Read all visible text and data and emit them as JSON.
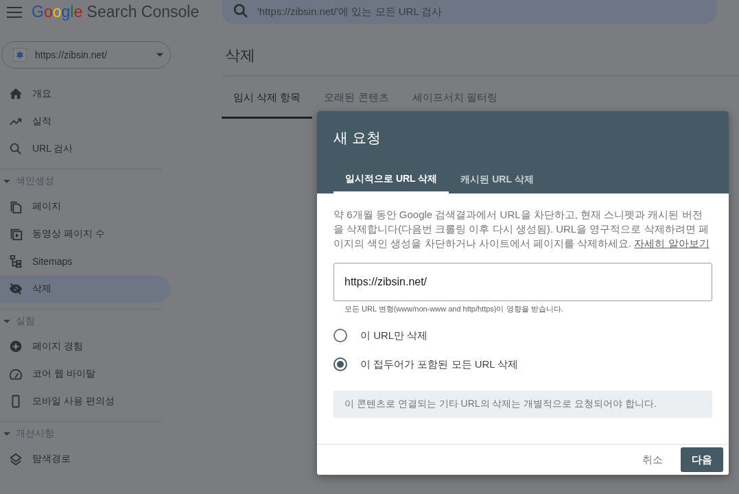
{
  "header": {
    "logo_brand": "Google",
    "logo_product": "Search Console",
    "search": {
      "placeholder": "'https://zibsin.net/'에 있는 모든 URL 검사"
    }
  },
  "property_selector": {
    "value": "https://zibsin.net/"
  },
  "sidebar": {
    "items": [
      {
        "label": "개요",
        "selected": false
      },
      {
        "label": "실적",
        "selected": false
      },
      {
        "label": "URL 검사",
        "selected": false
      }
    ],
    "sections": [
      {
        "title": "색인생성",
        "expanded": true,
        "items": [
          {
            "label": "페이지",
            "selected": false
          },
          {
            "label": "동영상 페이지 수",
            "selected": false
          },
          {
            "label": "Sitemaps",
            "selected": false
          },
          {
            "label": "삭제",
            "selected": true
          }
        ]
      },
      {
        "title": "실험",
        "expanded": true,
        "items": [
          {
            "label": "페이지 경험",
            "selected": false
          },
          {
            "label": "코어 웹 바이탈",
            "selected": false
          },
          {
            "label": "모바일 사용 편의성",
            "selected": false
          }
        ]
      },
      {
        "title": "개선사항",
        "expanded": true,
        "items": [
          {
            "label": "탐색경로",
            "selected": false
          }
        ]
      }
    ]
  },
  "page": {
    "title": "삭제",
    "tabs": [
      {
        "label": "임시 삭제 항목",
        "selected": true
      },
      {
        "label": "오래된 콘텐츠",
        "selected": false
      },
      {
        "label": "세이프서치 필터링",
        "selected": false
      }
    ]
  },
  "dialog": {
    "title": "새 요청",
    "tabs": [
      {
        "label": "일시적으로 URL 삭제",
        "selected": true
      },
      {
        "label": "캐시된 URL 삭제",
        "selected": false
      }
    ],
    "description": "약 6개월 동안 Google 검색결과에서 URL을 차단하고, 현재 스니펫과 캐시된 버전을 삭제합니다(다음번 크롤링 이후 다시 생성됨). URL을 영구적으로 삭제하려면 페이지의 색인 생성을 차단하거나 사이트에서 페이지를 삭제하세요.",
    "learn_more": "자세히 알아보기",
    "url_input": {
      "value": "https://zibsin.net/"
    },
    "helper": "모든 URL 변형(www/non-www and http/https)이 영향을 받습니다.",
    "options": [
      {
        "label": "이 URL만 삭제",
        "selected": false
      },
      {
        "label": "이 접두어가 포함된 모든 URL 삭제",
        "selected": true
      }
    ],
    "notice": "이 콘텐츠로 연결되는 기타 URL의 삭제는 개별적으로 요청되어야 합니다.",
    "buttons": [
      {
        "label": "취소",
        "kind": "text"
      },
      {
        "label": "다음",
        "kind": "primary"
      }
    ]
  }
}
